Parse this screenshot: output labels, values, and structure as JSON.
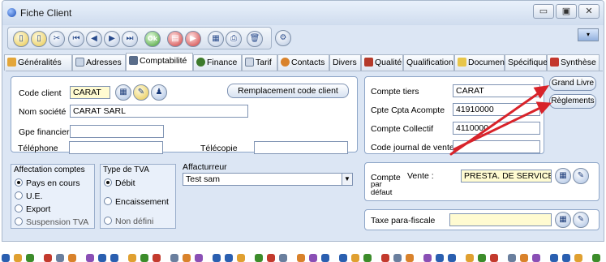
{
  "window": {
    "title": "Fiche Client",
    "controls": [
      "▭",
      "▣",
      "✕"
    ]
  },
  "toolbar": {
    "buttons": [
      {
        "name": "new",
        "glyph": "▯"
      },
      {
        "name": "duplicate",
        "glyph": "▯"
      },
      {
        "name": "search",
        "glyph": "✂"
      },
      {
        "name": "first",
        "glyph": "⏮"
      },
      {
        "name": "previous",
        "glyph": "◀"
      },
      {
        "name": "next",
        "glyph": "▶"
      },
      {
        "name": "last",
        "glyph": "⏭"
      },
      {
        "name": "ok",
        "glyph": "Ok"
      },
      {
        "name": "print-list",
        "glyph": "▤"
      },
      {
        "name": "exit",
        "glyph": "▶"
      },
      {
        "name": "print",
        "glyph": "▦"
      },
      {
        "name": "printer",
        "glyph": "⎙"
      },
      {
        "name": "delete",
        "glyph": "🗑"
      },
      {
        "name": "tools",
        "glyph": "⚙"
      }
    ],
    "dropdown_glyph": "▾"
  },
  "tabs": [
    {
      "label": "Généralités",
      "icon": "people-icon"
    },
    {
      "label": "Adresses",
      "icon": "address-icon"
    },
    {
      "label": "Comptabilité",
      "icon": "ledger-icon",
      "active": true
    },
    {
      "label": "Finance",
      "icon": "finance-icon"
    },
    {
      "label": "Tarif",
      "icon": "tarif-icon"
    },
    {
      "label": "Contacts",
      "icon": "contacts-icon"
    },
    {
      "label": "Divers",
      "icon": ""
    },
    {
      "label": "Qualité",
      "icon": "quality-icon"
    },
    {
      "label": "Qualification",
      "icon": ""
    },
    {
      "label": "Documents",
      "icon": "documents-icon"
    },
    {
      "label": "Spécifique",
      "icon": ""
    },
    {
      "label": "Synthèse",
      "icon": "synthese-icon"
    }
  ],
  "client": {
    "code_label": "Code client",
    "code_value": "CARAT",
    "replace_button": "Remplacement code client",
    "societe_label": "Nom société",
    "societe_value": "CARAT SARL",
    "gpe_label": "Gpe financier",
    "gpe_value": "",
    "tel_label": "Téléphone",
    "tel_value": "",
    "telecopie_label": "Télécopie",
    "telecopie_value": ""
  },
  "comptes": {
    "tiers_label": "Compte tiers",
    "tiers_value": "CARAT",
    "acompte_label": "Cpte Cpta Acompte",
    "acompte_value": "41910000",
    "collectif_label": "Compte Collectif",
    "collectif_value": "4110000",
    "journal_label": "Code journal de vente",
    "journal_value": ""
  },
  "side_buttons": {
    "grand_livre": "Grand Livre",
    "reglements": "Règlements"
  },
  "affectation": {
    "title": "Affectation comptes",
    "options": [
      {
        "label": "Pays en cours",
        "checked": true,
        "disabled": false
      },
      {
        "label": "U.E.",
        "checked": false,
        "disabled": false
      },
      {
        "label": "Export",
        "checked": false,
        "disabled": false
      },
      {
        "label": "Suspension TVA",
        "checked": false,
        "disabled": true
      }
    ]
  },
  "tva": {
    "title": "Type de TVA",
    "options": [
      {
        "label": "Débit",
        "checked": true,
        "disabled": false
      },
      {
        "label": "Encaissement",
        "checked": false,
        "disabled": false
      },
      {
        "label": "Non défini",
        "checked": false,
        "disabled": true
      }
    ]
  },
  "affactureur": {
    "title": "Affacturreur",
    "value": "Test sam"
  },
  "vente": {
    "compte_label": "Compte",
    "vente_label": "Vente :",
    "par_defaut_label": "par\ndéfaut",
    "value": "PRESTA. DE SERVICES"
  },
  "taxe": {
    "label": "Taxe para-fiscale",
    "value": ""
  },
  "colors": {
    "arrow": "#d8232a",
    "accent": "#dce6f4"
  }
}
